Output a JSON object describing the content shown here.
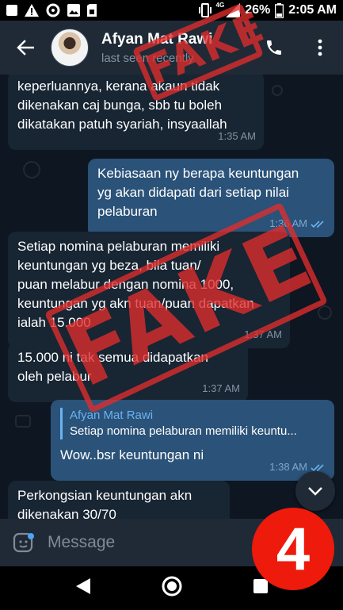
{
  "status_bar": {
    "network": "4G",
    "battery": "26%",
    "time": "2:05 AM"
  },
  "header": {
    "contact_name": "Afyan Mat Rawi",
    "contact_status": "last seen recently"
  },
  "messages": [
    {
      "direction": "in",
      "lines": [
        "keperluannya, kerana akaun tidak",
        "dikenakan caj bunga, sbb tu boleh",
        "dikatakan patuh syariah, insyaallah"
      ],
      "time": "1:35 AM"
    },
    {
      "direction": "out",
      "lines": [
        "Kebiasaan ny berapa keuntungan",
        "yg akan didapati dari setiap nilai",
        "pelaburan"
      ],
      "time": "1:36 AM",
      "read": true
    },
    {
      "direction": "in",
      "lines": [
        "Setiap nomina pelaburan memiliki",
        "keuntungan yg beza, bila tuan/",
        "puan melabur dengan nomina 1000,",
        "keuntungan yg akn tuan/puan dapatkan",
        "ialah 15.000"
      ],
      "time": "1:37 AM"
    },
    {
      "direction": "in",
      "lines": [
        "15.000 ni tak semua didapatkan",
        "oleh pelabur"
      ],
      "time": "1:37 AM"
    },
    {
      "direction": "out",
      "reply_to": {
        "name": "Afyan Mat Rawi",
        "text": "Setiap nomina pelaburan memiliki keuntu..."
      },
      "lines": [
        "Wow..bsr keuntungan ni"
      ],
      "time": "1:38 AM",
      "read": true
    },
    {
      "direction": "in",
      "lines": [
        "Perkongsian keuntungan akn",
        "dikenakan 30/70"
      ],
      "time": ""
    }
  ],
  "composer": {
    "placeholder": "Message"
  },
  "overlays": {
    "stamp_text": "FAKE",
    "badge_number": "4"
  },
  "colors": {
    "header_bg": "#1f2a36",
    "chat_bg": "#0e1621",
    "incoming_bubble": "#182533",
    "outgoing_bubble": "#2b5278",
    "stamp_red": "#e02d2d",
    "badge_red": "#ee1a0b",
    "reply_accent": "#6ab3f3"
  }
}
